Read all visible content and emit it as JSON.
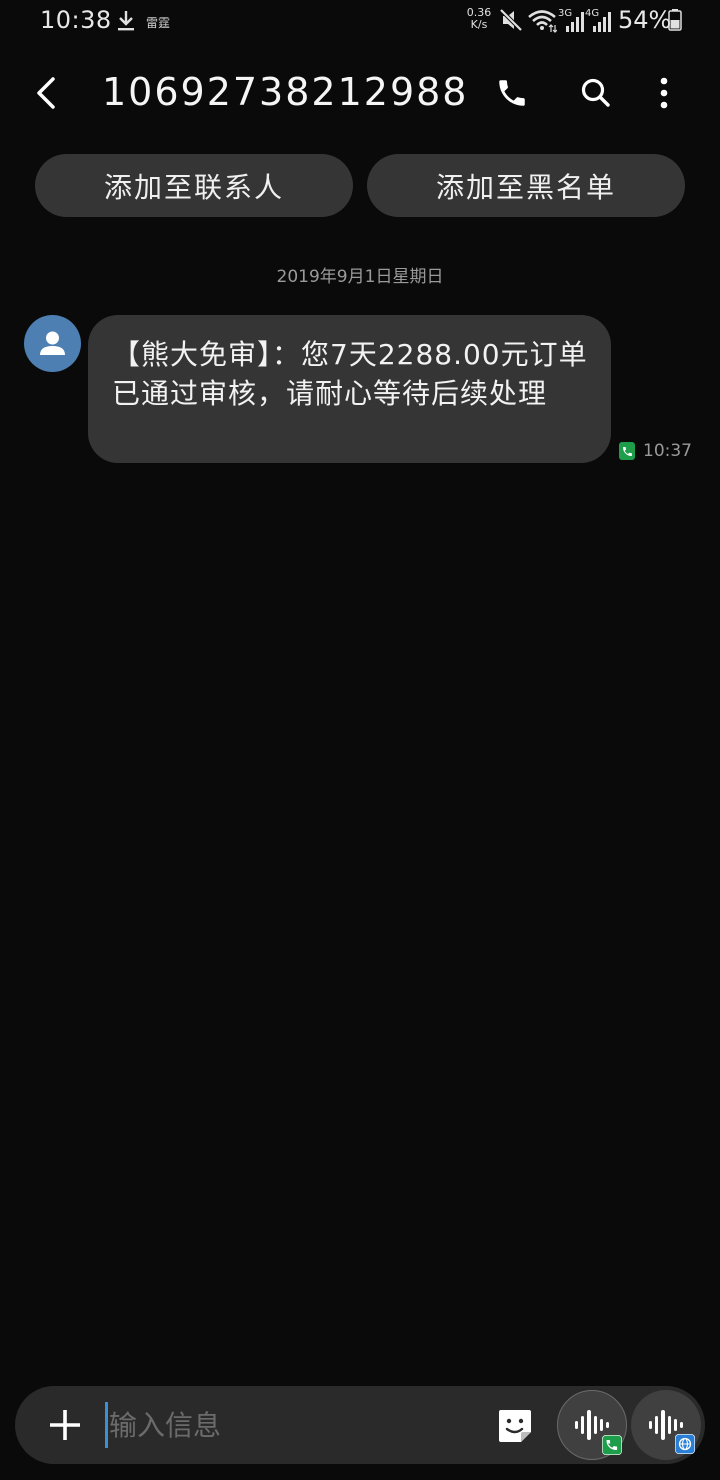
{
  "status_bar": {
    "time": "10:38",
    "app_label": "雷霆",
    "net_speed_value": "0.36",
    "net_speed_unit": "K/s",
    "sim1_network": "3G",
    "sim2_network": "4G",
    "battery": "54%"
  },
  "header": {
    "contact_number": "10692738212988",
    "icons": [
      "back-icon",
      "phone-icon",
      "search-icon",
      "more-vertical-icon"
    ]
  },
  "actions": {
    "add_contact": "添加至联系人",
    "add_blocklist": "添加至黑名单"
  },
  "conversation": {
    "date": "2019年9月1日星期日",
    "messages": [
      {
        "text": "【熊大免审】：您7天2288.00元订单已通过审核，请耐心等待后续处理",
        "time": "10:37",
        "sim_icon": "sim1-icon"
      }
    ]
  },
  "composer": {
    "placeholder": "输入信息",
    "icons": [
      "plus-icon",
      "sticker-icon",
      "send-sim1-icon",
      "send-sim2-icon"
    ]
  },
  "colors": {
    "background": "#0a0a0a",
    "bubble": "#353535",
    "avatar": "#4e7fb3",
    "sim1": "#1e9e4a",
    "sim2": "#2a7fd4",
    "cursor": "#3b8fd8"
  }
}
